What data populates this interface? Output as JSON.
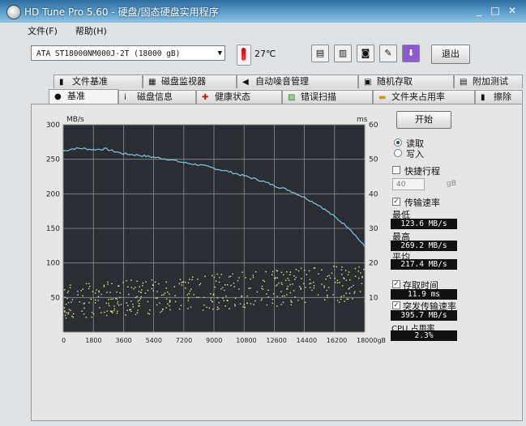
{
  "window": {
    "title": "HD Tune Pro 5.60 - 硬盘/固态硬盘实用程序"
  },
  "menu": {
    "file": "文件(F)",
    "help": "帮助(H)"
  },
  "toolbar": {
    "drive": "ATA    ST18000NM000J-2T (18000 gB)",
    "temperature": "27℃",
    "exit_label": "退出",
    "icons": [
      "copy-icon",
      "paste-icon",
      "camera-icon",
      "tools-icon",
      "download-icon"
    ]
  },
  "tabs_row1": [
    {
      "label": "文件基准",
      "icon": "file-icon"
    },
    {
      "label": "磁盘监视器",
      "icon": "monitor-icon"
    },
    {
      "label": "自动噪音管理",
      "icon": "speaker-icon"
    },
    {
      "label": "随机存取",
      "icon": "random-icon"
    },
    {
      "label": "附加测试",
      "icon": "extra-test-icon"
    }
  ],
  "tabs_row2": [
    {
      "label": "基准",
      "icon": "benchmark-icon",
      "active": true
    },
    {
      "label": "磁盘信息",
      "icon": "info-icon"
    },
    {
      "label": "健康状态",
      "icon": "health-icon"
    },
    {
      "label": "错误扫描",
      "icon": "scan-icon"
    },
    {
      "label": "文件夹占用率",
      "icon": "folder-icon"
    },
    {
      "label": "擦除",
      "icon": "erase-icon"
    }
  ],
  "chart_data": {
    "type": "line",
    "y_unit": "MB/s",
    "y2_unit": "ms",
    "x_unit": "gB",
    "y_ticks": [
      "300",
      "250",
      "200",
      "150",
      "100",
      "50"
    ],
    "y2_ticks": [
      "60",
      "50",
      "40",
      "30",
      "20",
      "10"
    ],
    "x_ticks": [
      "0",
      "1800",
      "3600",
      "5400",
      "7200",
      "9000",
      "10800",
      "12600",
      "14400",
      "16200",
      "18000gB"
    ],
    "ylim": [
      0,
      300
    ],
    "y2lim": [
      0,
      60
    ],
    "xlim": [
      0,
      18000
    ],
    "grid": true,
    "series": [
      {
        "role": "transfer-rate",
        "color": "#7ec8e6",
        "x": [
          0,
          500,
          1000,
          1800,
          2500,
          3600,
          4500,
          5400,
          6300,
          7200,
          8100,
          9000,
          9900,
          10800,
          11700,
          12600,
          13500,
          14400,
          15300,
          16200,
          17100,
          18000
        ],
        "y": [
          262,
          265,
          266,
          264,
          265,
          258,
          256,
          253,
          250,
          245,
          242,
          237,
          232,
          226,
          220,
          212,
          205,
          195,
          183,
          167,
          150,
          123.6
        ]
      },
      {
        "role": "access-time",
        "color": "#e8e88a",
        "kind": "scatter-band",
        "x_start": 0,
        "x_end": 18000,
        "y2_low_start": 4,
        "y2_low_end": 9,
        "y2_high_start": 14,
        "y2_high_end": 20
      }
    ]
  },
  "side": {
    "start_label": "开始",
    "read_label": "读取",
    "write_label": "写入",
    "short_stroke_label": "快捷行程",
    "short_stroke_value": "40",
    "short_stroke_unit": "gB",
    "transfer_rate_label": "传输速率",
    "min_label": "最低",
    "min_value": "123.6 MB/s",
    "max_label": "最高",
    "max_value": "269.2 MB/s",
    "avg_label": "平均",
    "avg_value": "217.4 MB/s",
    "access_time_label": "存取时间",
    "access_time_value": "11.9 ms",
    "burst_rate_label": "突发传输速率",
    "burst_rate_value": "395.7 MB/s",
    "cpu_label": "CPU 占用率",
    "cpu_value": "2.3%"
  }
}
